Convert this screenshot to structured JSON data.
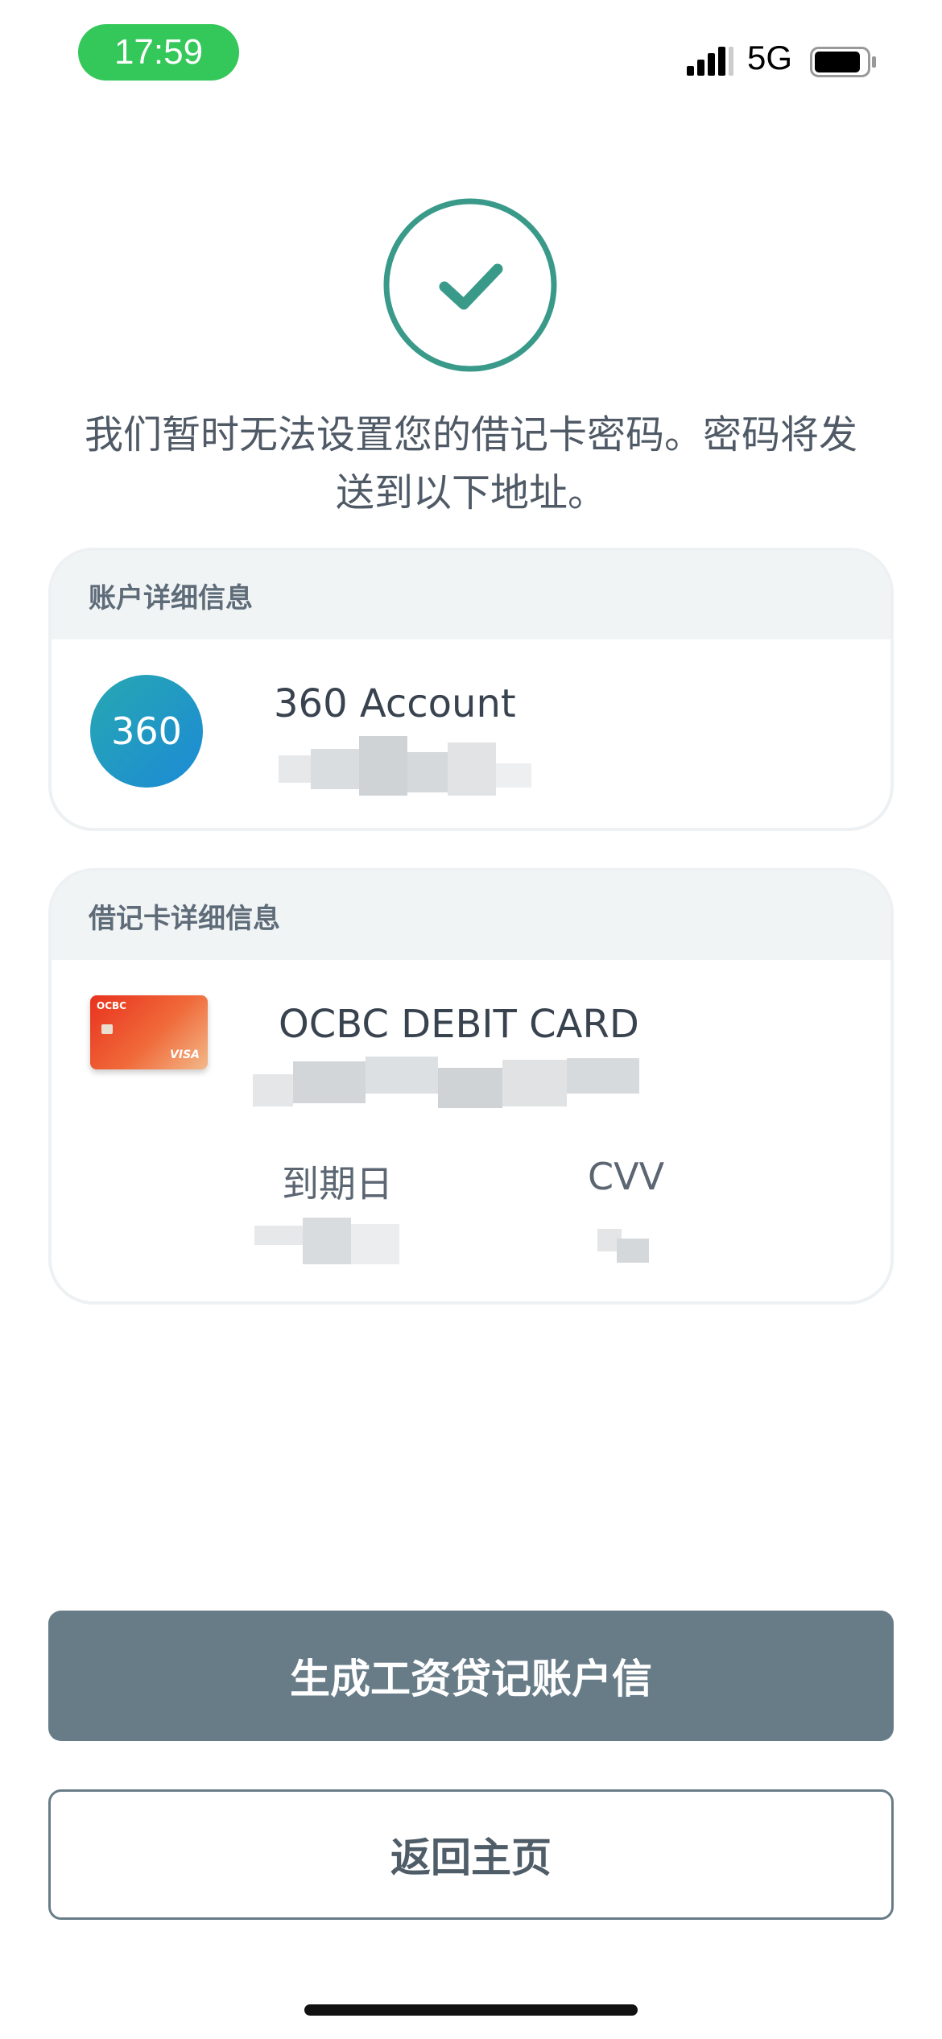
{
  "status_bar": {
    "time": "17:59",
    "network": "5G",
    "icons": [
      "signal-icon",
      "battery-icon"
    ]
  },
  "success": {
    "icon": "checkmark-icon",
    "color": "#3a9a8a",
    "message": "我们暂时无法设置您的借记卡密码。密码将发送到以下地址。"
  },
  "account_card": {
    "header": "账户详细信息",
    "avatar_label": "360",
    "name": "360 Account"
  },
  "debit_card": {
    "header": "借记卡详细信息",
    "name": "OCBC DEBIT CARD",
    "thumb_brand": "OCBC",
    "thumb_network": "VISA",
    "expiry_label": "到期日",
    "cvv_label": "CVV"
  },
  "actions": {
    "primary": "生成工资贷记账户信",
    "secondary": "返回主页"
  },
  "colors": {
    "button_primary": "#687c88",
    "status_pill": "#34c759",
    "header_bg": "#f1f4f5"
  }
}
